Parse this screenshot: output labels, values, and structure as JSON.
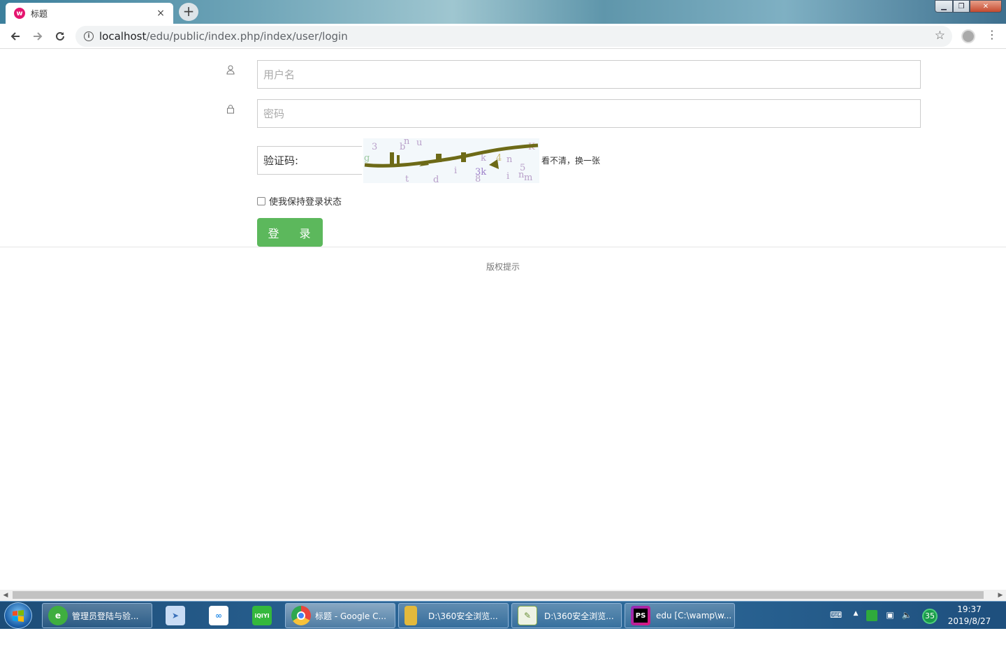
{
  "browser": {
    "tab_title": "标题",
    "tab_favicon_letter": "w",
    "tab_close": "×",
    "new_tab": "+",
    "url_host": "localhost",
    "url_path": "/edu/public/index.php/index/user/login",
    "info_symbol": "i"
  },
  "window_controls": {
    "minimize": "▁",
    "maximize": "❐",
    "close": "✕"
  },
  "login": {
    "username_placeholder": "用户名",
    "password_placeholder": "密码",
    "captcha_label": "验证码:",
    "captcha_refresh": "看不清，换一张",
    "remember_label": "使我保持登录状态",
    "submit_label": "登 录",
    "copyright": "版权提示"
  },
  "taskbar": {
    "items": [
      {
        "label": "管理员登陆与验...",
        "icon": "360-browser-icon",
        "color": "#3fae3f"
      },
      {
        "label": "标题 - Google C...",
        "icon": "chrome-icon",
        "color": "#e9463c"
      },
      {
        "label": "D:\\360安全浏览...",
        "icon": "folder-icon",
        "color": "#e3b93c"
      },
      {
        "label": "D:\\360安全浏览...",
        "icon": "notepad-icon",
        "color": "#7fa74a"
      },
      {
        "label": "edu [C:\\wamp\\w...",
        "icon": "phpstorm-icon",
        "color": "#8a2fb9"
      }
    ],
    "pinned": [
      {
        "icon": "feishu-icon",
        "color": "#c9dcf5"
      },
      {
        "icon": "baidu-netdisk-icon",
        "color": "#2a8ee8"
      },
      {
        "icon": "iqiyi-icon",
        "color": "#34b83c",
        "text": "iQIYI"
      }
    ],
    "tray_badge": "35",
    "time": "19:37",
    "date": "2019/8/27"
  }
}
